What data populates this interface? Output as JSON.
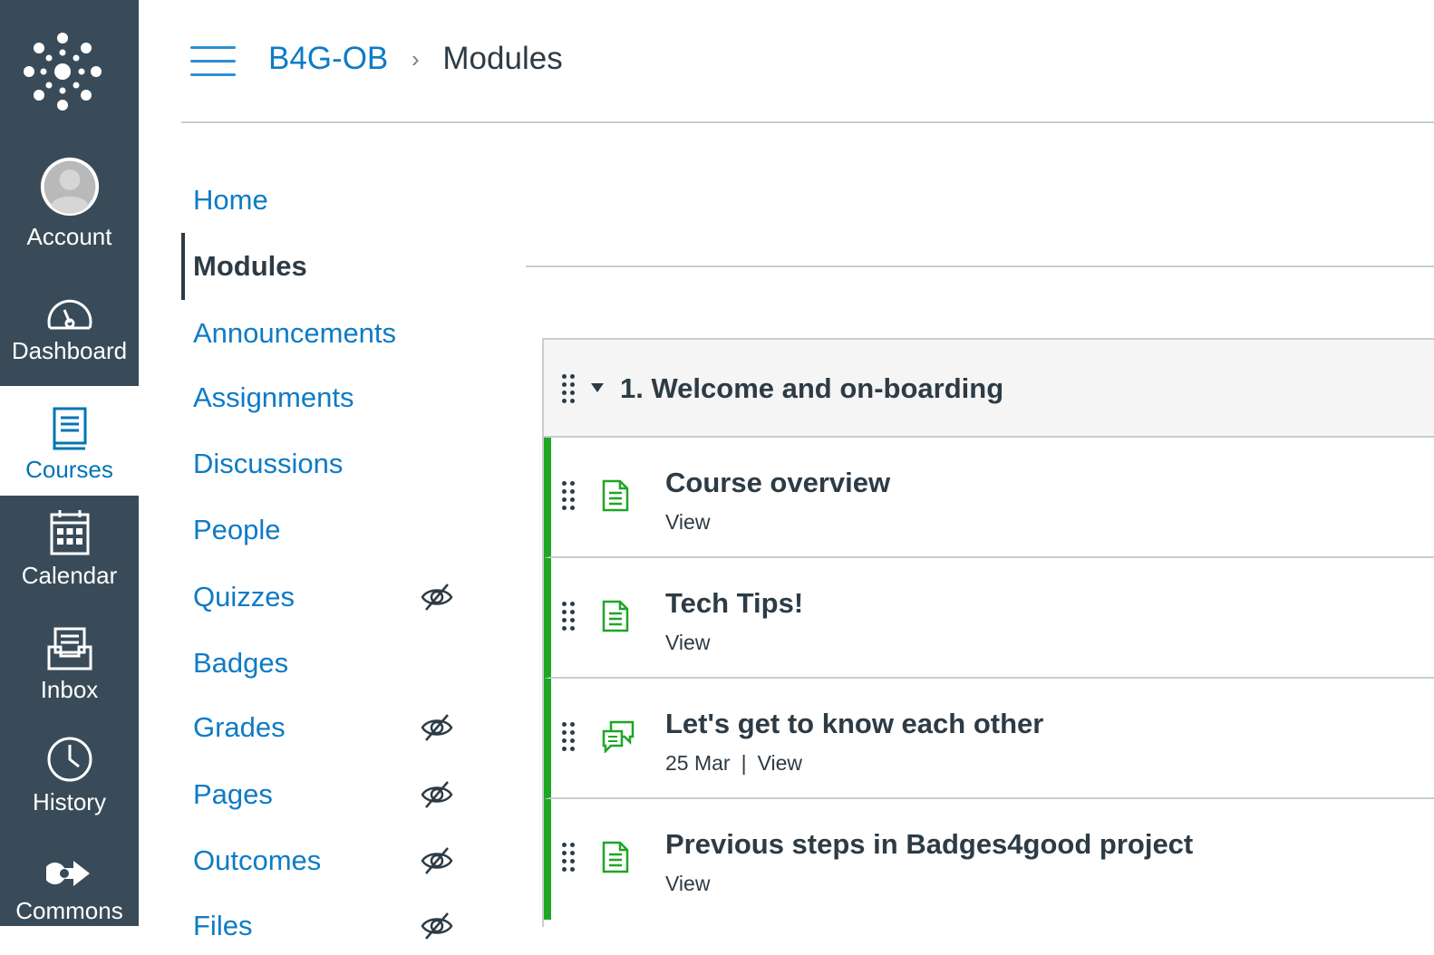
{
  "global_nav": {
    "logo_icon": "canvas-logo-icon",
    "items": [
      {
        "label": "Account",
        "icon": "avatar-icon",
        "active": false
      },
      {
        "label": "Dashboard",
        "icon": "dashboard-icon",
        "active": false
      },
      {
        "label": "Courses",
        "icon": "courses-icon",
        "active": true
      },
      {
        "label": "Calendar",
        "icon": "calendar-icon",
        "active": false
      },
      {
        "label": "Inbox",
        "icon": "inbox-icon",
        "active": false
      },
      {
        "label": "History",
        "icon": "clock-icon",
        "active": false
      },
      {
        "label": "Commons",
        "icon": "commons-icon",
        "active": false
      }
    ],
    "colors": {
      "background": "#394b58",
      "active_background": "#ffffff",
      "active_text": "#0374b5"
    }
  },
  "header": {
    "menu_icon": "hamburger-icon",
    "breadcrumb": {
      "course": "B4G-OB",
      "separator": "›",
      "current": "Modules"
    }
  },
  "course_nav": {
    "items": [
      {
        "label": "Home",
        "hidden": false,
        "active": false
      },
      {
        "label": "Modules",
        "hidden": false,
        "active": true
      },
      {
        "label": "Announcements",
        "hidden": false,
        "active": false
      },
      {
        "label": "Assignments",
        "hidden": false,
        "active": false
      },
      {
        "label": "Discussions",
        "hidden": false,
        "active": false
      },
      {
        "label": "People",
        "hidden": false,
        "active": false
      },
      {
        "label": "Quizzes",
        "hidden": true,
        "active": false
      },
      {
        "label": "Badges",
        "hidden": false,
        "active": false
      },
      {
        "label": "Grades",
        "hidden": true,
        "active": false
      },
      {
        "label": "Pages",
        "hidden": true,
        "active": false
      },
      {
        "label": "Outcomes",
        "hidden": true,
        "active": false
      },
      {
        "label": "Files",
        "hidden": true,
        "active": false
      }
    ],
    "hidden_icon": "eye-slash-icon",
    "link_color": "#0e7bc6"
  },
  "module": {
    "title": "1. Welcome and on-boarding",
    "expanded": true,
    "items": [
      {
        "title": "Course overview",
        "type": "page",
        "icon": "page-icon",
        "date": "",
        "action": "View"
      },
      {
        "title": "Tech Tips!",
        "type": "page",
        "icon": "page-icon",
        "date": "",
        "action": "View"
      },
      {
        "title": "Let's get to know each other",
        "type": "discussion",
        "icon": "discussion-icon",
        "date": "25 Mar",
        "action": "View"
      },
      {
        "title": "Previous steps in Badges4good project",
        "type": "page",
        "icon": "page-icon",
        "date": "",
        "action": "View"
      }
    ],
    "published_color": "#1fa625"
  }
}
